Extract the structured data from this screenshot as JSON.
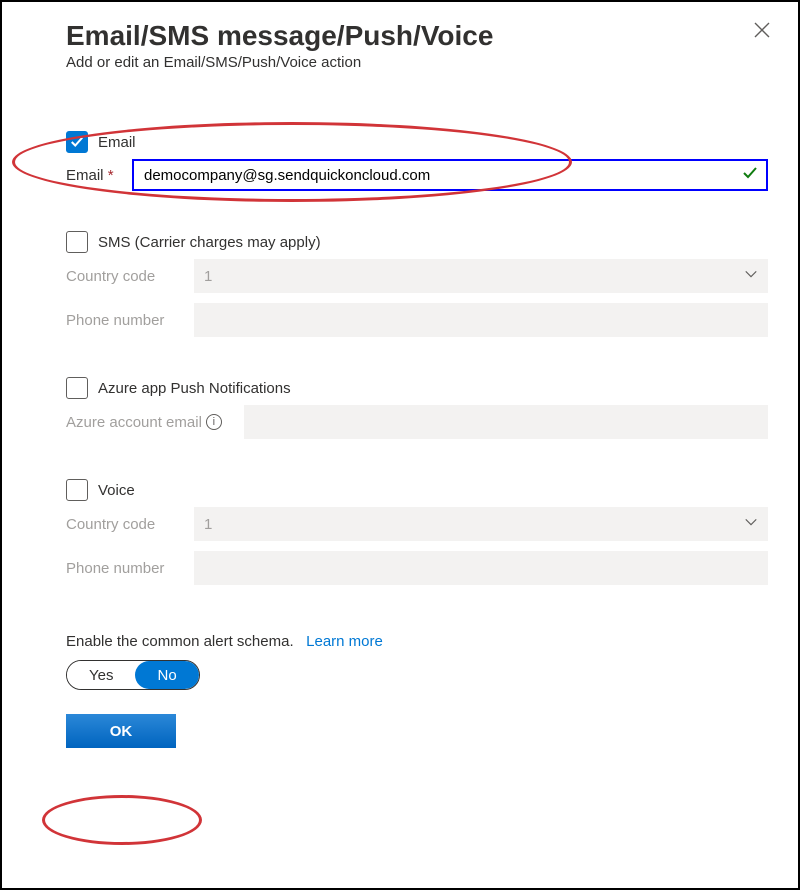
{
  "header": {
    "title": "Email/SMS message/Push/Voice",
    "subtitle": "Add or edit an Email/SMS/Push/Voice action"
  },
  "email": {
    "checkbox_label": "Email",
    "field_label": "Email",
    "required_marker": "*",
    "value": "democompany@sg.sendquickoncloud.com"
  },
  "sms": {
    "checkbox_label": "SMS (Carrier charges may apply)",
    "country_code_label": "Country code",
    "country_code_value": "1",
    "phone_label": "Phone number"
  },
  "push": {
    "checkbox_label": "Azure app Push Notifications",
    "account_label": "Azure account email"
  },
  "voice": {
    "checkbox_label": "Voice",
    "country_code_label": "Country code",
    "country_code_value": "1",
    "phone_label": "Phone number"
  },
  "schema": {
    "label": "Enable the common alert schema.",
    "learn_more": "Learn more",
    "yes": "Yes",
    "no": "No"
  },
  "actions": {
    "ok": "OK"
  }
}
